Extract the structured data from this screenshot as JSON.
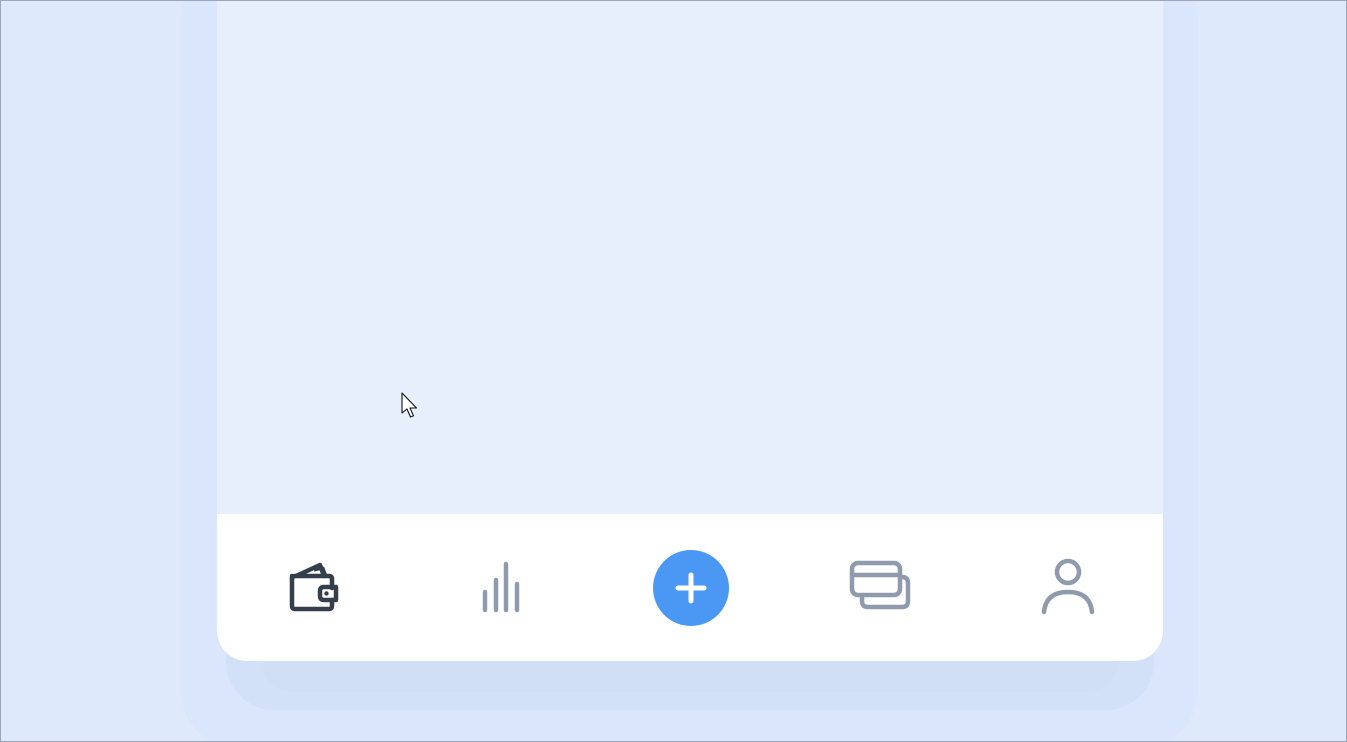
{
  "colors": {
    "background": "#dee9fc",
    "content": "#e7effd",
    "nav_bg": "#ffffff",
    "active_icon": "#353e4b",
    "inactive_icon": "#8f9bad",
    "accent": "#4b97f4"
  },
  "bottom_nav": {
    "items": [
      {
        "icon": "wallet-icon",
        "active": true
      },
      {
        "icon": "bar-chart-icon",
        "active": false
      },
      {
        "icon": "plus-icon",
        "active": false
      },
      {
        "icon": "cards-icon",
        "active": false
      },
      {
        "icon": "user-icon",
        "active": false
      }
    ]
  }
}
